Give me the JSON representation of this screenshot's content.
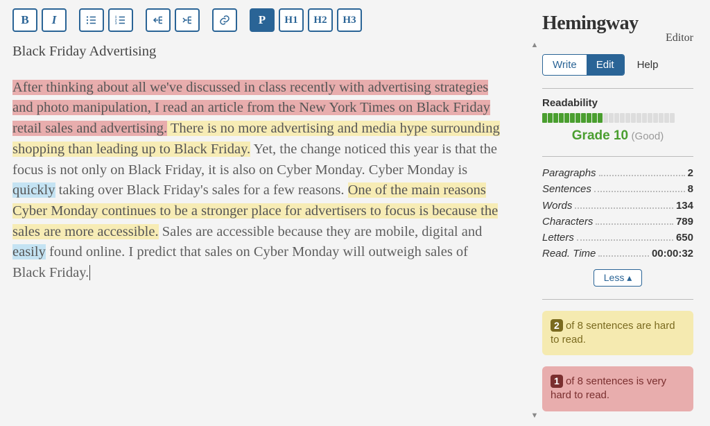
{
  "toolbar": {
    "bold": "B",
    "italic": "I",
    "ul": "list-ul",
    "ol": "list-ol",
    "outdent": "outdent",
    "indent": "indent",
    "link": "link",
    "p": "P",
    "h1": "H1",
    "h2": "H2",
    "h3": "H3"
  },
  "document": {
    "title": "Black Friday Advertising",
    "seg_vhard": "After thinking about all we've discussed in class recently with advertising strategies and photo manipulation, I read an article from the New York Times on Black Friday retail sales and advertising.",
    "seg_hard1": " There is no more advertising and media hype surrounding shopping than leading up to Black Friday.",
    "seg_plain1": " Yet, the change noticed this year is that the focus is not only on Black Friday, it is also on Cyber Monday. Cyber Monday is ",
    "seg_adv1": "quickly",
    "seg_plain2": " taking over Black Friday's sales for a few reasons. ",
    "seg_hard2": "One of the main reasons Cyber Monday continues to be a stronger place for advertisers to focus is because the sales are more accessible.",
    "seg_plain3": " Sales are accessible because they are mobile, digital and ",
    "seg_adv2": "easily",
    "seg_plain4": " found online. I predict that sales on Cyber Monday will outweigh sales of Black Friday. "
  },
  "brand": {
    "name": "Hemingway",
    "sub": "Editor"
  },
  "tabs": {
    "write": "Write",
    "edit": "Edit",
    "help": "Help"
  },
  "readability": {
    "label": "Readability",
    "filled": 11,
    "total": 24,
    "grade": "Grade 10",
    "grade_note": "(Good)"
  },
  "stats": {
    "paragraphs": {
      "label": "Paragraphs",
      "value": "2"
    },
    "sentences": {
      "label": "Sentences",
      "value": "8"
    },
    "words": {
      "label": "Words",
      "value": "134"
    },
    "characters": {
      "label": "Characters",
      "value": "789"
    },
    "letters": {
      "label": "Letters",
      "value": "650"
    },
    "readtime": {
      "label": "Read. Time",
      "value": "00:00:32"
    }
  },
  "less_button": "Less ▴",
  "tips": {
    "hard": {
      "count": "2",
      "text": " of 8 sentences are hard to read."
    },
    "vhard": {
      "count": "1",
      "text": " of 8 sentences is very hard to read."
    }
  }
}
